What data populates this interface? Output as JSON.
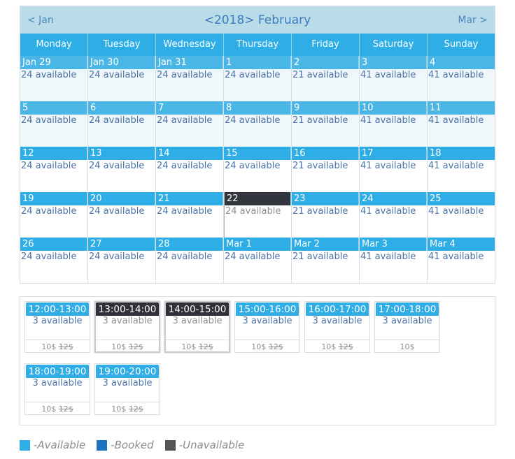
{
  "calendar": {
    "title": "<2018> February",
    "prev_label": "< Jan",
    "next_label": "Mar >",
    "weekdays": [
      "Monday",
      "Tuesday",
      "Wednesday",
      "Thursday",
      "Friday",
      "Saturday",
      "Sunday"
    ],
    "weeks": [
      {
        "past": true,
        "days": [
          {
            "label": "Jan 29",
            "avail": "24 available"
          },
          {
            "label": "Jan 30",
            "avail": "24 available"
          },
          {
            "label": "Jan 31",
            "avail": "24 available"
          },
          {
            "label": "1",
            "avail": "24 available"
          },
          {
            "label": "2",
            "avail": "21 available"
          },
          {
            "label": "3",
            "avail": "41 available"
          },
          {
            "label": "4",
            "avail": "41 available"
          }
        ]
      },
      {
        "past": true,
        "days": [
          {
            "label": "5",
            "avail": "24 available"
          },
          {
            "label": "6",
            "avail": "24 available"
          },
          {
            "label": "7",
            "avail": "24 available"
          },
          {
            "label": "8",
            "avail": "24 available"
          },
          {
            "label": "9",
            "avail": "21 available"
          },
          {
            "label": "10",
            "avail": "41 available"
          },
          {
            "label": "11",
            "avail": "41 available"
          }
        ]
      },
      {
        "past": false,
        "days": [
          {
            "label": "12",
            "avail": "24 available"
          },
          {
            "label": "13",
            "avail": "24 available"
          },
          {
            "label": "14",
            "avail": "24 available"
          },
          {
            "label": "15",
            "avail": "24 available"
          },
          {
            "label": "16",
            "avail": "21 available"
          },
          {
            "label": "17",
            "avail": "41 available"
          },
          {
            "label": "18",
            "avail": "41 available"
          }
        ]
      },
      {
        "past": false,
        "days": [
          {
            "label": "19",
            "avail": "24 available"
          },
          {
            "label": "20",
            "avail": "24 available"
          },
          {
            "label": "21",
            "avail": "24 available"
          },
          {
            "label": "22",
            "avail": "24 available",
            "selected": true
          },
          {
            "label": "23",
            "avail": "21 available"
          },
          {
            "label": "24",
            "avail": "41 available"
          },
          {
            "label": "25",
            "avail": "41 available"
          }
        ]
      },
      {
        "past": false,
        "days": [
          {
            "label": "26",
            "avail": "24 available"
          },
          {
            "label": "27",
            "avail": "24 available"
          },
          {
            "label": "28",
            "avail": "24 available"
          },
          {
            "label": "Mar 1",
            "avail": "24 available"
          },
          {
            "label": "Mar 2",
            "avail": "21 available"
          },
          {
            "label": "Mar 3",
            "avail": "41 available"
          },
          {
            "label": "Mar 4",
            "avail": "41 available"
          }
        ]
      }
    ]
  },
  "slots": [
    {
      "time": "12:00-13:00",
      "avail": "3 available",
      "price": "10$",
      "old_price": "12$",
      "status": "available"
    },
    {
      "time": "13:00-14:00",
      "avail": "3 available",
      "price": "10$",
      "old_price": "12$",
      "status": "unavailable"
    },
    {
      "time": "14:00-15:00",
      "avail": "3 available",
      "price": "10$",
      "old_price": "12$",
      "status": "unavailable"
    },
    {
      "time": "15:00-16:00",
      "avail": "3 available",
      "price": "10$",
      "old_price": "12$",
      "status": "available"
    },
    {
      "time": "16:00-17:00",
      "avail": "3 available",
      "price": "10$",
      "old_price": "12$",
      "status": "available"
    },
    {
      "time": "17:00-18:00",
      "avail": "3 available",
      "price": "10$",
      "old_price": "",
      "status": "available"
    },
    {
      "time": "18:00-19:00",
      "avail": "3 available",
      "price": "10$",
      "old_price": "12$",
      "status": "available"
    },
    {
      "time": "19:00-20:00",
      "avail": "3 available",
      "price": "10$",
      "old_price": "12$",
      "status": "available"
    }
  ],
  "legend": [
    {
      "label": "-Available",
      "color": "#2fade6"
    },
    {
      "label": "-Booked",
      "color": "#1e73be"
    },
    {
      "label": "-Unavailable",
      "color": "#555555"
    }
  ]
}
